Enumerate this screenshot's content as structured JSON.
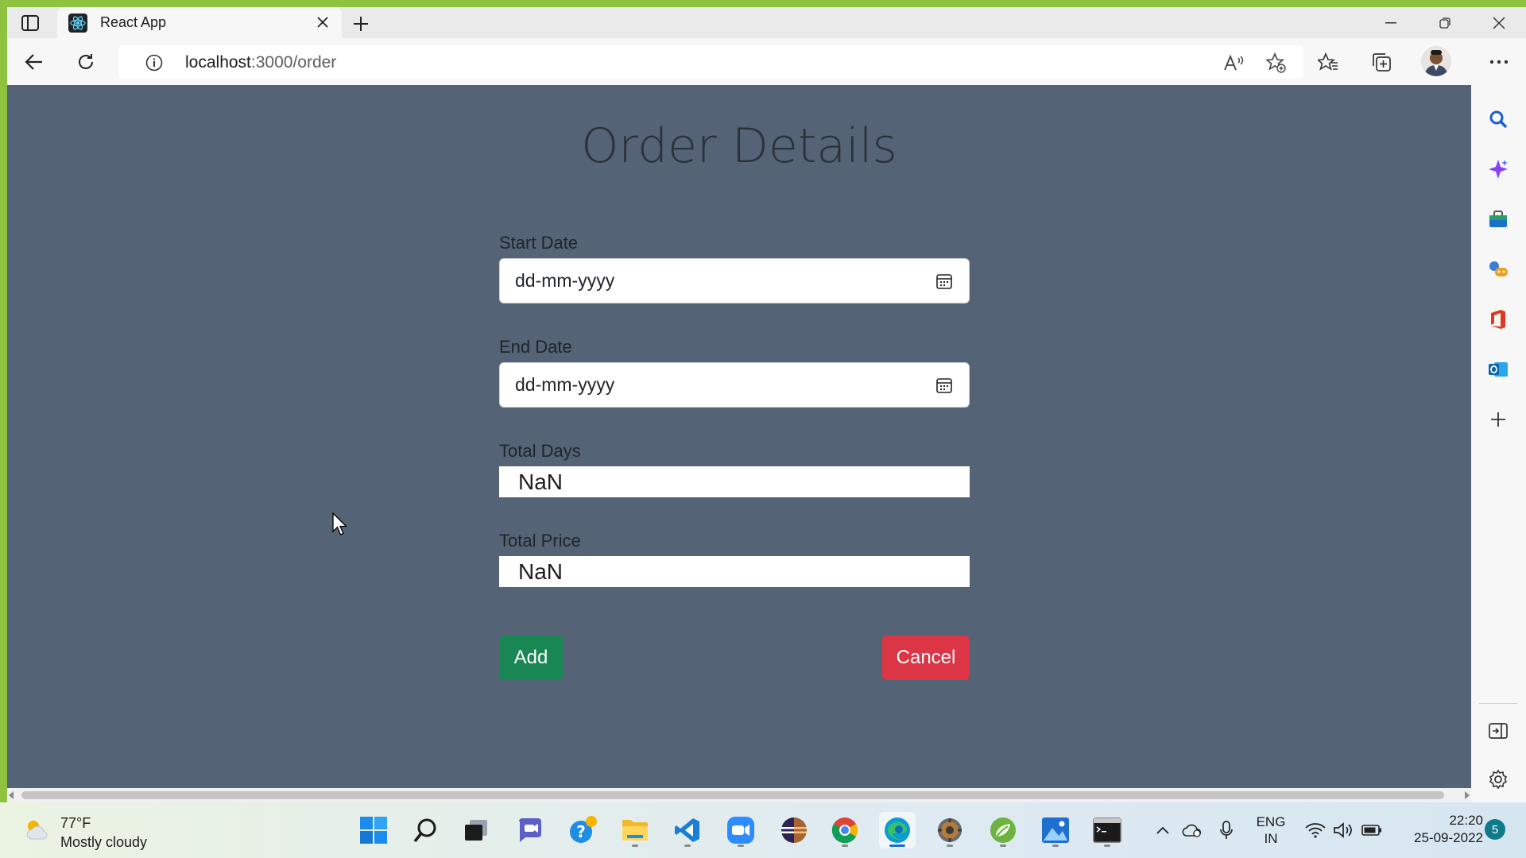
{
  "browser": {
    "tab_title": "React App",
    "url_host": "localhost",
    "url_path": ":3000/order",
    "icons": {
      "tab_actions": "tab-actions-icon",
      "favicon": "react-icon",
      "close_tab": "close-icon",
      "new_tab": "plus-icon",
      "minimize": "minimize-icon",
      "restore": "restore-icon",
      "close_window": "close-icon",
      "back": "back-arrow-icon",
      "refresh": "refresh-icon",
      "site_info": "info-icon",
      "read_aloud": "read-aloud-icon",
      "add_favorite": "star-plus-icon",
      "favorites": "favorites-icon",
      "collections": "collections-icon",
      "profile": "avatar",
      "more": "more-icon"
    }
  },
  "page": {
    "title": "Order Details",
    "start_date": {
      "label": "Start Date",
      "placeholder": "dd-mm-yyyy"
    },
    "end_date": {
      "label": "End Date",
      "placeholder": "dd-mm-yyyy"
    },
    "total_days": {
      "label": "Total Days",
      "value": "NaN"
    },
    "total_price": {
      "label": "Total Price",
      "value": "NaN"
    },
    "add_label": "Add",
    "cancel_label": "Cancel",
    "colors": {
      "background": "#546375",
      "add": "#198754",
      "cancel": "#dc3545"
    }
  },
  "sidebar": {
    "icons": [
      "search-icon",
      "copilot-icon",
      "shopping-icon",
      "games-icon",
      "office-icon",
      "outlook-icon",
      "plus-icon",
      "hide-sidebar-icon",
      "settings-icon"
    ]
  },
  "taskbar": {
    "weather": {
      "temp": "77°F",
      "condition": "Mostly cloudy"
    },
    "apps": [
      "windows-start-icon",
      "search-icon",
      "task-view-icon",
      "teams-chat-icon",
      "help-icon",
      "file-explorer-icon",
      "vscode-icon",
      "zoom-icon",
      "eclipse-icon",
      "chrome-icon",
      "edge-icon",
      "settings-app-icon",
      "spring-icon",
      "photos-icon",
      "terminal-icon"
    ],
    "lang_line1": "ENG",
    "lang_line2": "IN",
    "time": "22:20",
    "date": "25-09-2022",
    "notification_count": "5"
  }
}
